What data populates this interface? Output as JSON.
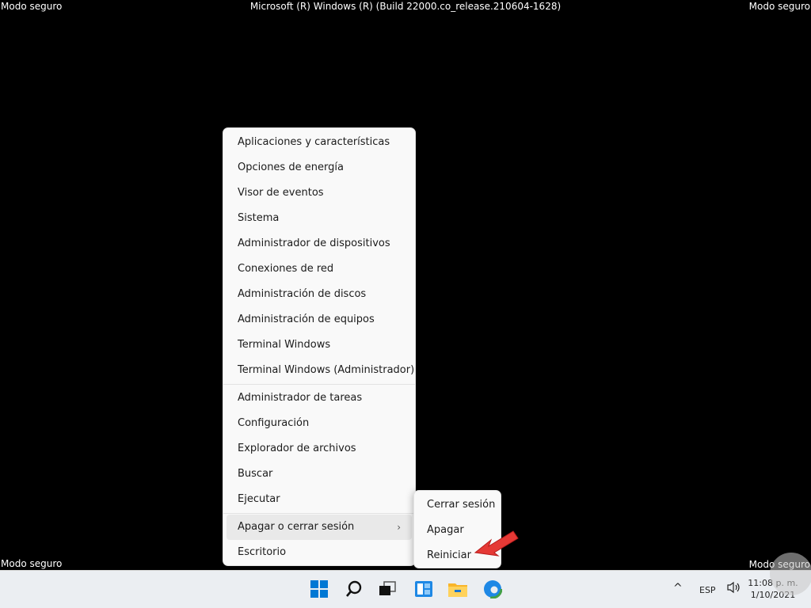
{
  "overlay": {
    "safe_mode": "Modo seguro",
    "build": "Microsoft (R) Windows (R) (Build 22000.co_release.210604-1628)"
  },
  "winx_menu": {
    "group1": [
      "Aplicaciones y características",
      "Opciones de energía",
      "Visor de eventos",
      "Sistema",
      "Administrador de dispositivos",
      "Conexiones de red",
      "Administración de discos",
      "Administración de equipos",
      "Terminal Windows",
      "Terminal Windows (Administrador)"
    ],
    "group2": [
      "Administrador de tareas",
      "Configuración",
      "Explorador de archivos",
      "Buscar",
      "Ejecutar"
    ],
    "shutdown": "Apagar o cerrar sesión",
    "desktop": "Escritorio"
  },
  "submenu": {
    "items": [
      "Cerrar sesión",
      "Apagar",
      "Reiniciar"
    ]
  },
  "taskbar": {
    "icons": [
      "windows-start-icon",
      "search-icon",
      "task-view-icon",
      "widgets-icon",
      "file-explorer-icon",
      "edge-icon"
    ],
    "tray": {
      "chevron": "^",
      "lang": "ESP",
      "time": "11:08 p. m.",
      "date": "1/10/2021"
    }
  },
  "colors": {
    "accent_blue": "#0078d4",
    "arrow_red": "#e53935"
  }
}
